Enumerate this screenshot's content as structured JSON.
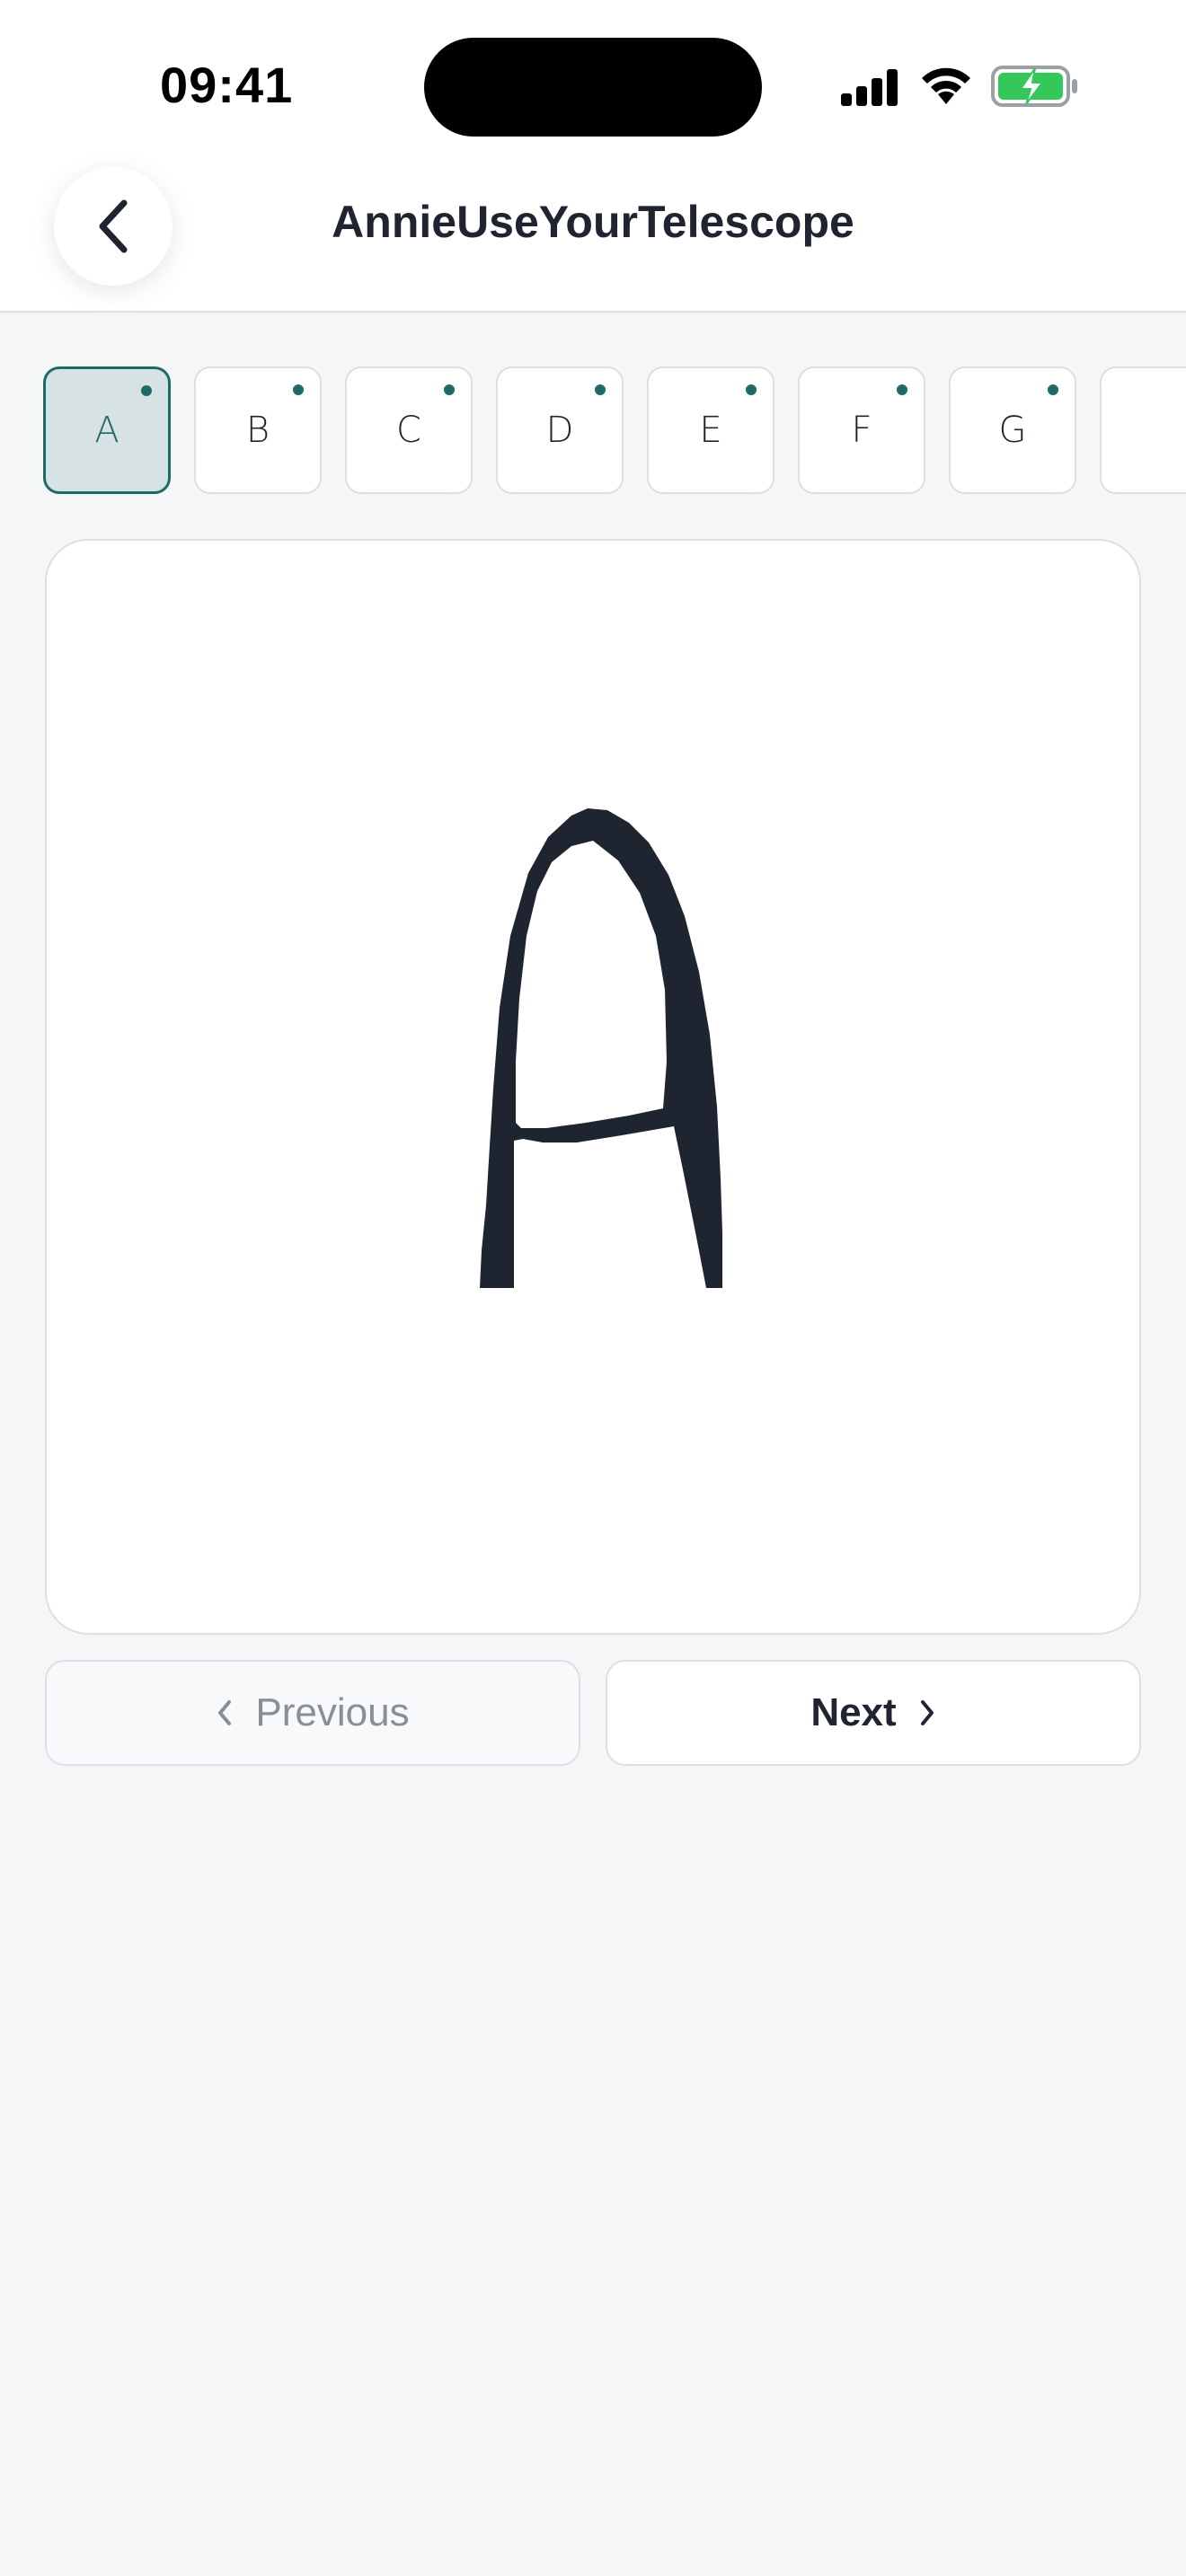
{
  "status_bar": {
    "time": "09:41",
    "icons": [
      "cellular-signal-icon",
      "wifi-icon",
      "battery-charging-icon"
    ],
    "battery_color": "#34c759"
  },
  "header": {
    "title": "AnnieUseYourTelescope",
    "back_icon": "chevron-left-icon"
  },
  "glyphs": [
    {
      "label": "A",
      "selected": true
    },
    {
      "label": "B",
      "selected": false
    },
    {
      "label": "C",
      "selected": false
    },
    {
      "label": "D",
      "selected": false
    },
    {
      "label": "E",
      "selected": false
    },
    {
      "label": "F",
      "selected": false
    },
    {
      "label": "G",
      "selected": false
    }
  ],
  "preview": {
    "glyph": "A"
  },
  "navigation": {
    "previous_label": "Previous",
    "next_label": "Next",
    "previous_enabled": false
  },
  "colors": {
    "accent": "#1e6b66",
    "selected_tile_bg": "#d6e2e4",
    "glyph_ink": "#1f2530"
  }
}
